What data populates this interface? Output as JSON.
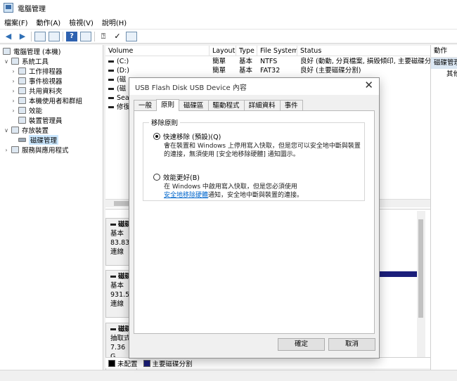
{
  "window": {
    "title": "電腦管理"
  },
  "menus": [
    "檔案(F)",
    "動作(A)",
    "檢視(V)",
    "說明(H)"
  ],
  "tree": {
    "root": "電腦管理 (本機)",
    "system_tools": "系統工具",
    "task_scheduler": "工作排程器",
    "event_viewer": "事件檢視器",
    "shared_folders": "共用資料夾",
    "local_users": "本機使用者和群組",
    "performance": "效能",
    "device_manager": "裝置管理員",
    "storage": "存放裝置",
    "disk_management": "磁碟管理",
    "services_apps": "服務與應用程式"
  },
  "volume_list": {
    "headers": [
      "Volume",
      "Layout",
      "Type",
      "File System",
      "Status"
    ],
    "rows": [
      [
        "(C:)",
        "簡單",
        "基本",
        "NTFS",
        "良好 (動動, 分頁檔案, 損毀傾印, 主要磁碟分割)"
      ],
      [
        "(D:)",
        "簡單",
        "基本",
        "FAT32",
        "良好 (主要磁碟分割)"
      ],
      [
        "(磁",
        "",
        "",
        "",
        ""
      ],
      [
        "(磁",
        "",
        "",
        "",
        ""
      ],
      [
        "Sea",
        "",
        "",
        "",
        ""
      ],
      [
        "修復",
        "",
        "",
        "",
        ""
      ]
    ]
  },
  "disks": [
    {
      "name": "磁碟",
      "type": "基本",
      "size": "83.83",
      "state": "連線"
    },
    {
      "name": "磁碟",
      "type": "基本",
      "size": "931.5",
      "state": "連線"
    },
    {
      "name": "磁碟",
      "type": "抽取式",
      "size": "7.36 G",
      "state": "連線"
    }
  ],
  "legend": {
    "unallocated": "未配置",
    "primary": "主要磁碟分割"
  },
  "actions": {
    "header": "動作",
    "item1": "磁碟管理",
    "item2": "其他"
  },
  "dialog": {
    "title": "USB Flash Disk USB Device 內容",
    "tabs": [
      "一般",
      "原則",
      "磁碟區",
      "驅動程式",
      "詳細資料",
      "事件"
    ],
    "group_title": "移除原則",
    "option1_label": "快速移除 (預設)(Q)",
    "option1_desc": "會在裝置和 Windows 上停用寫入快取，但是您可以安全地中斷與裝置的連接，無須使用 [安全地移除硬體] 通知圖示。",
    "option2_label": "效能更好(B)",
    "option2_desc_1": "在 Windows 中啟用寫入快取，但是您必須使用",
    "option2_link": "安全地移除硬體",
    "option2_desc_2": "通知，安全地中斷與裝置的連接。",
    "ok": "確定",
    "cancel": "取消"
  },
  "colors": {
    "accent": "#0066cc",
    "primary_partition": "#1b1e7a",
    "selection": "#cce8ff"
  }
}
